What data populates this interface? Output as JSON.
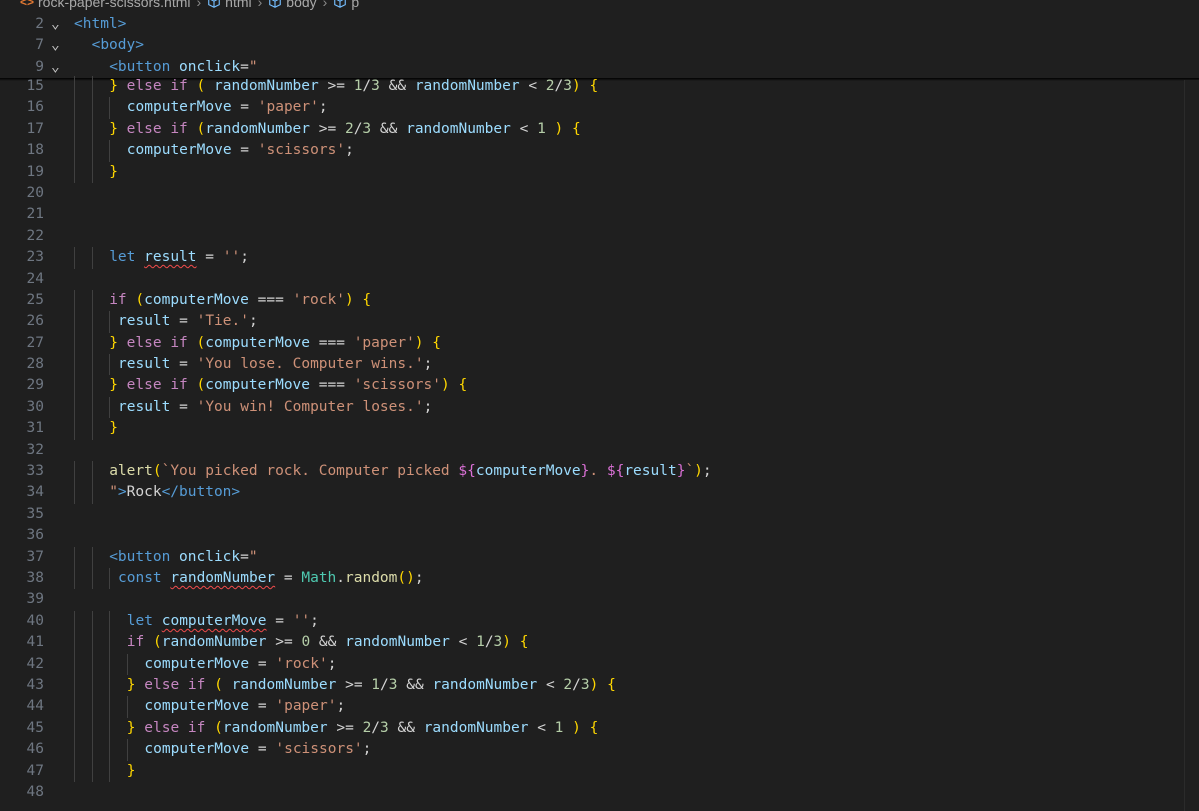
{
  "breadcrumb": {
    "file": "rock-paper-scissors.html",
    "items": [
      "html",
      "body",
      "p"
    ]
  },
  "sticky": [
    {
      "num": "2",
      "indent": 0,
      "text": "<html>"
    },
    {
      "num": "7",
      "indent": 1,
      "text": "<body>"
    },
    {
      "num": "9",
      "indent": 2,
      "text": "<button onclick=\""
    }
  ],
  "lines": [
    {
      "num": "15",
      "indent": 2,
      "text": "} else if ( randomNumber >= 1/3 && randomNumber < 2/3) {"
    },
    {
      "num": "16",
      "indent": 3,
      "text": "computerMove = 'paper';"
    },
    {
      "num": "17",
      "indent": 2,
      "text": "} else if (randomNumber >= 2/3 && randomNumber < 1 ) {"
    },
    {
      "num": "18",
      "indent": 3,
      "text": "computerMove = 'scissors';"
    },
    {
      "num": "19",
      "indent": 2,
      "text": "}"
    },
    {
      "num": "20",
      "indent": 0,
      "text": ""
    },
    {
      "num": "21",
      "indent": 0,
      "text": ""
    },
    {
      "num": "22",
      "indent": 0,
      "text": ""
    },
    {
      "num": "23",
      "indent": 2,
      "text": "let result = '';"
    },
    {
      "num": "24",
      "indent": 0,
      "text": ""
    },
    {
      "num": "25",
      "indent": 2,
      "text": "if (computerMove === 'rock') {"
    },
    {
      "num": "26",
      "indent": 2.5,
      "text": "result = 'Tie.';"
    },
    {
      "num": "27",
      "indent": 2,
      "text": "} else if (computerMove === 'paper') {"
    },
    {
      "num": "28",
      "indent": 2.5,
      "text": "result = 'You lose. Computer wins.';"
    },
    {
      "num": "29",
      "indent": 2,
      "text": "} else if (computerMove === 'scissors') {"
    },
    {
      "num": "30",
      "indent": 2.5,
      "text": "result = 'You win! Computer loses.';"
    },
    {
      "num": "31",
      "indent": 2,
      "text": "}"
    },
    {
      "num": "32",
      "indent": 0,
      "text": ""
    },
    {
      "num": "33",
      "indent": 2,
      "text": "alert(`You picked rock. Computer picked ${computerMove}. ${result}`);"
    },
    {
      "num": "34",
      "indent": 2,
      "text": "\">Rock</button>"
    },
    {
      "num": "35",
      "indent": 0,
      "text": ""
    },
    {
      "num": "36",
      "indent": 0,
      "text": ""
    },
    {
      "num": "37",
      "indent": 2,
      "text": "<button onclick=\""
    },
    {
      "num": "38",
      "indent": 2.5,
      "text": "const randomNumber = Math.random();"
    },
    {
      "num": "39",
      "indent": 0,
      "text": ""
    },
    {
      "num": "40",
      "indent": 3,
      "text": "let computerMove = '';"
    },
    {
      "num": "41",
      "indent": 3,
      "text": "if (randomNumber >= 0 && randomNumber < 1/3) {"
    },
    {
      "num": "42",
      "indent": 4,
      "text": "computerMove = 'rock';"
    },
    {
      "num": "43",
      "indent": 3,
      "text": "} else if ( randomNumber >= 1/3 && randomNumber < 2/3) {"
    },
    {
      "num": "44",
      "indent": 4,
      "text": "computerMove = 'paper';"
    },
    {
      "num": "45",
      "indent": 3,
      "text": "} else if (randomNumber >= 2/3 && randomNumber < 1 ) {"
    },
    {
      "num": "46",
      "indent": 4,
      "text": "computerMove = 'scissors';"
    },
    {
      "num": "47",
      "indent": 3,
      "text": "}"
    },
    {
      "num": "48",
      "indent": 0,
      "text": ""
    }
  ]
}
